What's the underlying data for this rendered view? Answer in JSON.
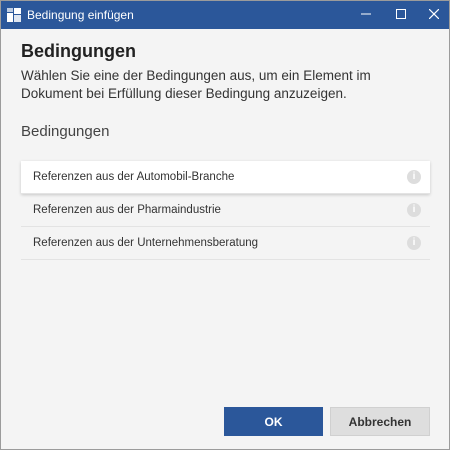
{
  "window": {
    "title": "Bedingung einfügen",
    "app_icon": "word-app-icon",
    "controls": {
      "minimize_icon": "minimize-icon",
      "maximize_icon": "maximize-icon",
      "close_icon": "close-icon"
    }
  },
  "header": {
    "title": "Bedingungen",
    "description": "Wählen Sie eine der Bedingungen aus, um ein Element im Dokument bei Erfüllung dieser Bedingung anzuzeigen."
  },
  "conditions": {
    "section_title": "Bedingungen",
    "info_icon": "info-icon",
    "items": [
      {
        "label": "Referenzen aus der Automobil-Branche",
        "selected": true
      },
      {
        "label": "Referenzen aus der Pharmaindustrie",
        "selected": false
      },
      {
        "label": "Referenzen aus der Unternehmensberatung",
        "selected": false
      }
    ]
  },
  "footer": {
    "ok_label": "OK",
    "cancel_label": "Abbrechen"
  },
  "colors": {
    "accent": "#2b579a",
    "background": "#f4f4f4",
    "secondary_button": "#dedede"
  }
}
